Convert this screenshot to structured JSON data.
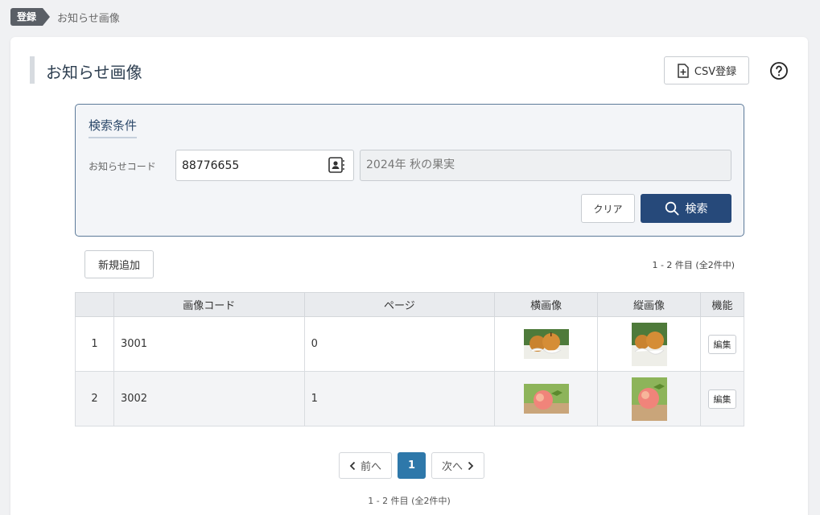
{
  "breadcrumb": {
    "tag": "登録",
    "current": "お知らせ画像"
  },
  "header": {
    "title": "お知らせ画像",
    "csv_label": "CSV登録"
  },
  "search": {
    "heading": "検索条件",
    "code_label": "お知らせコード",
    "code_value": "88776655",
    "name_value": "2024年 秋の果実",
    "clear_label": "クリア",
    "search_label": "検索"
  },
  "toolbar": {
    "add_label": "新規追加",
    "count_text": "1 - 2 件目 (全2件中)"
  },
  "table": {
    "columns": [
      "画像コード",
      "ページ",
      "横画像",
      "縦画像",
      "機能"
    ],
    "rows": [
      {
        "index": "1",
        "code": "3001",
        "page": "0",
        "image": "pear",
        "edit_label": "編集"
      },
      {
        "index": "2",
        "code": "3002",
        "page": "1",
        "image": "peach",
        "edit_label": "編集"
      }
    ]
  },
  "pagination": {
    "prev_label": "前へ",
    "current": "1",
    "next_label": "次へ",
    "count_text": "1 - 2 件目 (全2件中)"
  },
  "colors": {
    "primary": "#26497a",
    "page_active": "#2e78aa",
    "panel_border": "#5c7a99"
  }
}
